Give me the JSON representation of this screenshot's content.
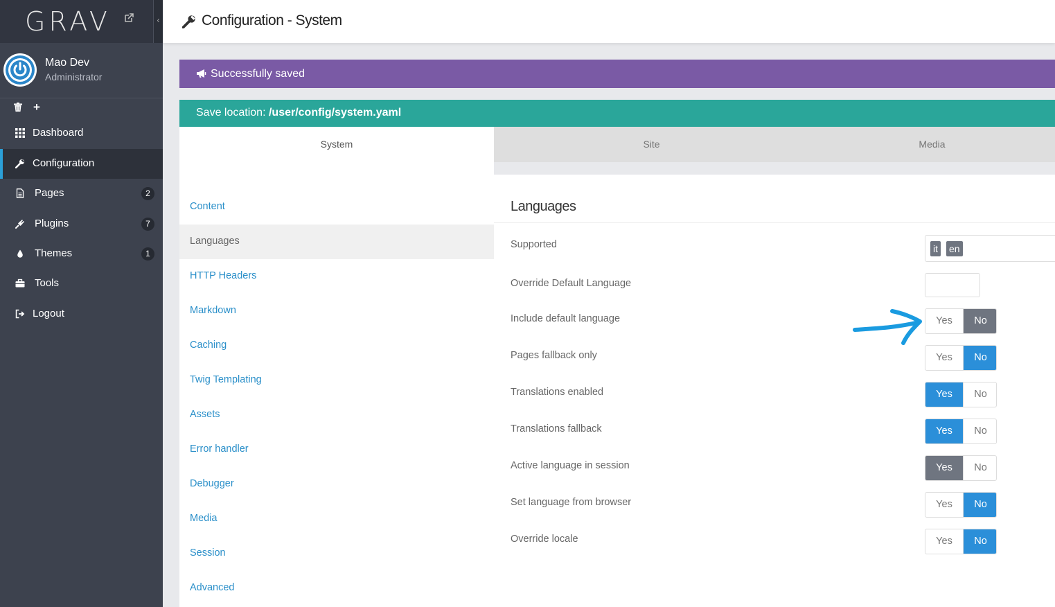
{
  "sidebar": {
    "logo": "GRAV",
    "user": {
      "name": "Mao Dev",
      "role": "Administrator"
    },
    "nav": [
      {
        "label": "Dashboard",
        "icon": "grid-icon",
        "badge": ""
      },
      {
        "label": "Configuration",
        "icon": "wrench-icon",
        "badge": "",
        "active": true
      },
      {
        "label": "Pages",
        "icon": "file-icon",
        "badge": "2"
      },
      {
        "label": "Plugins",
        "icon": "plug-icon",
        "badge": "7"
      },
      {
        "label": "Themes",
        "icon": "tint-icon",
        "badge": "1"
      },
      {
        "label": "Tools",
        "icon": "briefcase-icon",
        "badge": ""
      },
      {
        "label": "Logout",
        "icon": "sign-out-icon",
        "badge": ""
      }
    ]
  },
  "header": {
    "title": "Configuration - System"
  },
  "banners": {
    "saved": "Successfully saved",
    "location_label": "Save location:",
    "location_path": "/user/config/system.yaml"
  },
  "tabs": [
    "System",
    "Site",
    "Media"
  ],
  "sections": [
    "Content",
    "Languages",
    "HTTP Headers",
    "Markdown",
    "Caching",
    "Twig Templating",
    "Assets",
    "Error handler",
    "Debugger",
    "Media",
    "Session",
    "Advanced"
  ],
  "panel": {
    "title": "Languages",
    "supported_label": "Supported",
    "supported_tags": [
      "it",
      "en"
    ],
    "override_default_label": "Override Default Language",
    "override_default_value": "",
    "toggles": [
      {
        "label": "Include default language",
        "yes": "Yes",
        "no": "No",
        "selected": "No"
      },
      {
        "label": "Pages fallback only",
        "yes": "Yes",
        "no": "No",
        "selected": "No"
      },
      {
        "label": "Translations enabled",
        "yes": "Yes",
        "no": "No",
        "selected": "Yes"
      },
      {
        "label": "Translations fallback",
        "yes": "Yes",
        "no": "No",
        "selected": "Yes"
      },
      {
        "label": "Active language in session",
        "yes": "Yes",
        "no": "No",
        "selected": "Yes"
      },
      {
        "label": "Set language from browser",
        "yes": "Yes",
        "no": "No",
        "selected": "No"
      },
      {
        "label": "Override locale",
        "yes": "Yes",
        "no": "No",
        "selected": "No"
      }
    ]
  },
  "colors": {
    "sidebar_bg": "#3d424e",
    "accent_blue": "#2b8fd9",
    "saved_banner": "#7a5aa5",
    "location_banner": "#2aa69a",
    "annotation_arrow": "#1a9be0"
  }
}
